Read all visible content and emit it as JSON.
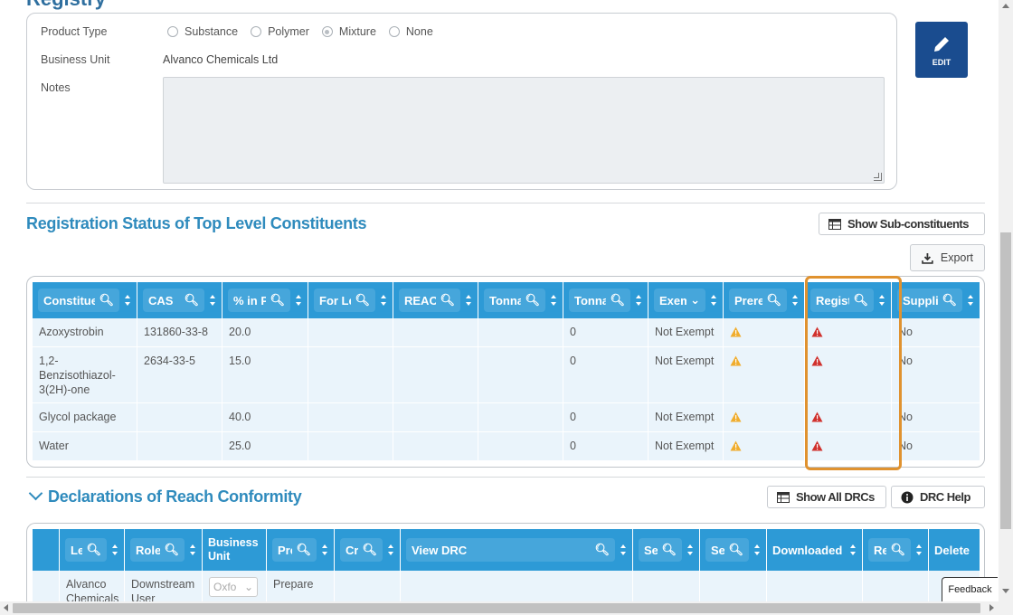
{
  "top_heading_clip": "Registry",
  "info": {
    "product_type_label": "Product Type",
    "product_type_options": [
      "Substance",
      "Polymer",
      "Mixture",
      "None"
    ],
    "product_type_selected": "Mixture",
    "business_unit_label": "Business Unit",
    "business_unit_value": "Alvanco Chemicals Ltd",
    "notes_label": "Notes"
  },
  "edit_button": {
    "label": "EDIT"
  },
  "registration": {
    "title": "Registration Status of Top Level Constituents",
    "show_sub_label": "Show Sub-constituents",
    "export_label": "Export",
    "columns": [
      "Constituent",
      "CAS",
      "% in Product",
      "For Legal Entity",
      "REACH",
      "Tonnage",
      "Tonnage",
      "Exempt",
      "Preregistered",
      "Registered",
      "Supplier"
    ],
    "rows": [
      {
        "constituent": "Azoxystrobin",
        "cas": "131860-33-8",
        "pct": "20.0",
        "tonnage2": "0",
        "exempt": "Not Exempt",
        "supplier": "No"
      },
      {
        "constituent": "1,2-Benzisothiazol-3(2H)-one",
        "cas": "2634-33-5",
        "pct": "15.0",
        "tonnage2": "0",
        "exempt": "Not Exempt",
        "supplier": "No"
      },
      {
        "constituent": "Glycol package",
        "cas": "",
        "pct": "40.0",
        "tonnage2": "0",
        "exempt": "Not Exempt",
        "supplier": "No"
      },
      {
        "constituent": "Water",
        "cas": "",
        "pct": "25.0",
        "tonnage2": "0",
        "exempt": "Not Exempt",
        "supplier": "No"
      }
    ],
    "colors": {
      "preregistered_warning": "#f0ad2e",
      "registered_warning": "#d0312d",
      "header": "#2d9ad6",
      "highlight": "#e0922f"
    }
  },
  "declarations": {
    "title": "Declarations of Reach Conformity",
    "show_all_label": "Show All DRCs",
    "help_label": "DRC Help",
    "columns": [
      "Legal Entity",
      "Role",
      "Business Unit",
      "Prepared",
      "Created",
      "View DRC",
      "Sent",
      "Sent",
      "Downloaded",
      "Revoked",
      "Delete"
    ],
    "row": {
      "legal_entity": "Alvanco Chemicals",
      "role": "Downstream User",
      "bu_select": "Oxfo",
      "prepared": "Prepare"
    }
  },
  "feedback_label": "Feedback"
}
